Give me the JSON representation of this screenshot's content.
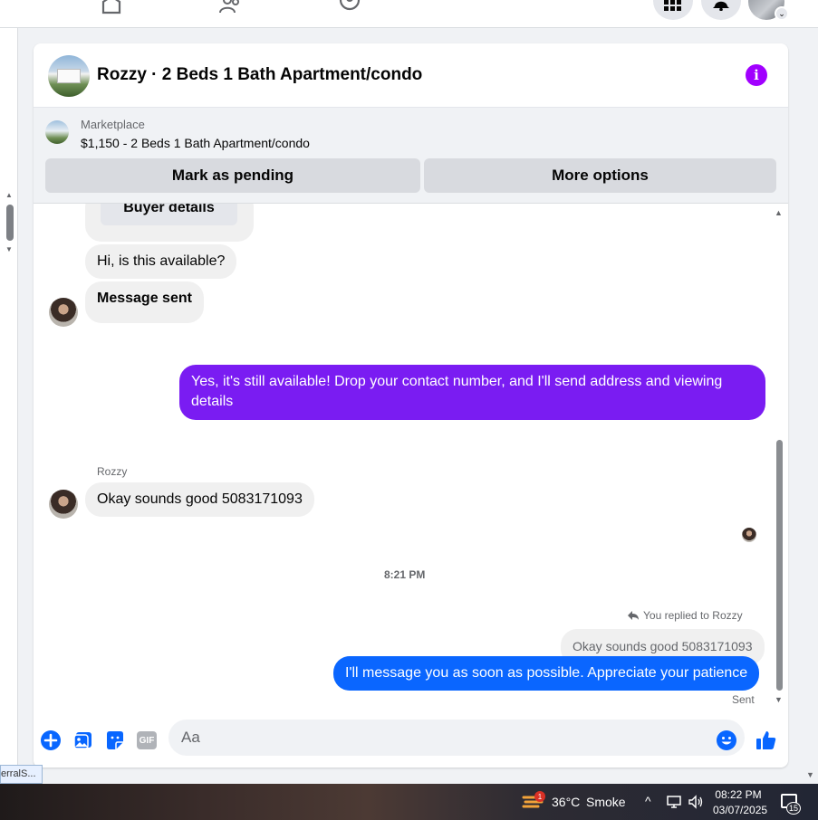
{
  "header": {
    "title": "Rozzy · 2 Beds 1 Bath Apartment/condo"
  },
  "marketplace": {
    "label": "Marketplace",
    "listing": "$1,150 - 2 Beds 1 Bath Apartment/condo",
    "mark_pending": "Mark as pending",
    "more_options": "More options"
  },
  "messages": {
    "buyer_details": "Buyer details",
    "m1": "Hi, is this available?",
    "m2": "Message sent",
    "m3": "Yes, it's still available! Drop your contact number, and I'll send address and viewing details",
    "sender": "Rozzy",
    "m4": "Okay sounds good 5083171093",
    "timestamp": "8:21 PM",
    "replied_to": "You replied to Rozzy",
    "quoted": "Okay sounds good 5083171093",
    "m5": "I'll message you as soon as possible. Appreciate your patience",
    "status": "Sent"
  },
  "composer": {
    "placeholder": "Aa",
    "gif_label": "GIF"
  },
  "tooltip": "erralS...",
  "taskbar": {
    "weather_badge": "1",
    "temperature": "36°C",
    "condition": "Smoke",
    "time": "08:22 PM",
    "date": "03/07/2025",
    "notification_count": "15"
  },
  "colors": {
    "accent_purple": "#7a1cf2",
    "accent_blue": "#0a66ff",
    "info": "#a100ff"
  }
}
